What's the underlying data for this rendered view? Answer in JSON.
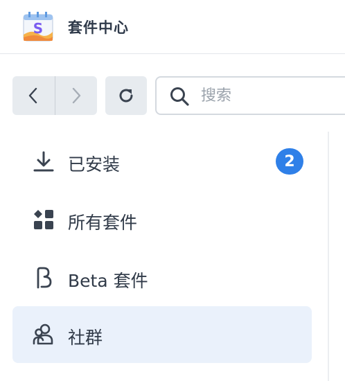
{
  "app": {
    "title": "套件中心",
    "logo_icon": "package-center-logo-icon"
  },
  "toolbar": {
    "back_icon": "chevron-left-icon",
    "forward_icon": "chevron-right-icon",
    "refresh_icon": "refresh-icon",
    "search": {
      "placeholder": "搜索",
      "value": "",
      "icon": "search-icon"
    }
  },
  "sidebar": {
    "items": [
      {
        "label": "已安装",
        "icon": "download-icon",
        "badge": "2",
        "active": false
      },
      {
        "label": "所有套件",
        "icon": "grid-icon",
        "active": false
      },
      {
        "label": "Beta 套件",
        "icon": "beta-icon",
        "active": false
      },
      {
        "label": "社群",
        "icon": "community-icon",
        "active": true
      }
    ]
  },
  "colors": {
    "accent": "#2f80e8",
    "active_bg": "#eaf1fb",
    "button_bg": "#e7ebef"
  }
}
